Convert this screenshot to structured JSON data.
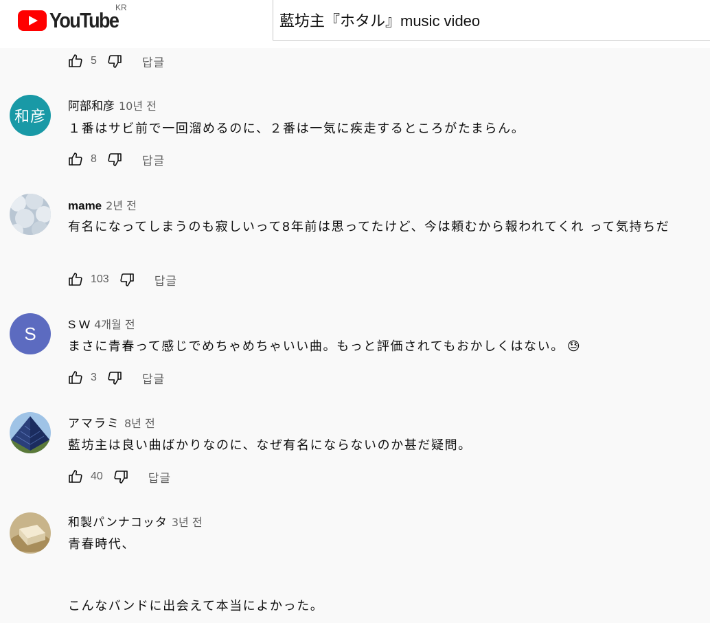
{
  "header": {
    "logo_text": "YouTube",
    "country_code": "KR",
    "search_value": "藍坊主『ホタル』music video"
  },
  "top_actions": {
    "likes": "5",
    "reply_label": "답글"
  },
  "comments": [
    {
      "author": "阿部和彦",
      "time": "10년 전",
      "avatar_text": "和彦",
      "avatar_color": "#1999a6",
      "text": "１番はサビ前で一回溜めるのに、２番は一気に疾走するところがたまらん。",
      "likes": "8",
      "reply_label": "답글"
    },
    {
      "author": "mame",
      "time": "2년 전",
      "text": "有名になってしまうのも寂しいって8年前は思ってたけど、今は頼むから報われてくれ って気持ちだ",
      "likes": "103",
      "reply_label": "답글"
    },
    {
      "author": "S W",
      "time": "4개월 전",
      "avatar_text": "S",
      "avatar_color": "#5c6bc0",
      "text": "まさに青春って感じでめちゃめちゃいい曲。もっと評価されてもおかしくはない。",
      "emoji": "😓",
      "likes": "3",
      "reply_label": "답글"
    },
    {
      "author": "アマラミ",
      "time": "8년 전",
      "text": "藍坊主は良い曲ばかりなのに、なぜ有名にならないのか甚だ疑問。",
      "likes": "40",
      "reply_label": "답글"
    },
    {
      "author": "和製パンナコッタ",
      "time": "3년 전",
      "text_line1": "青春時代、",
      "text_line2": "こんなバンドに出会えて本当によかった。"
    }
  ],
  "colors": {
    "background": "#f9f9f9",
    "secondary_text": "#606060",
    "logo_red": "#ff0000"
  }
}
